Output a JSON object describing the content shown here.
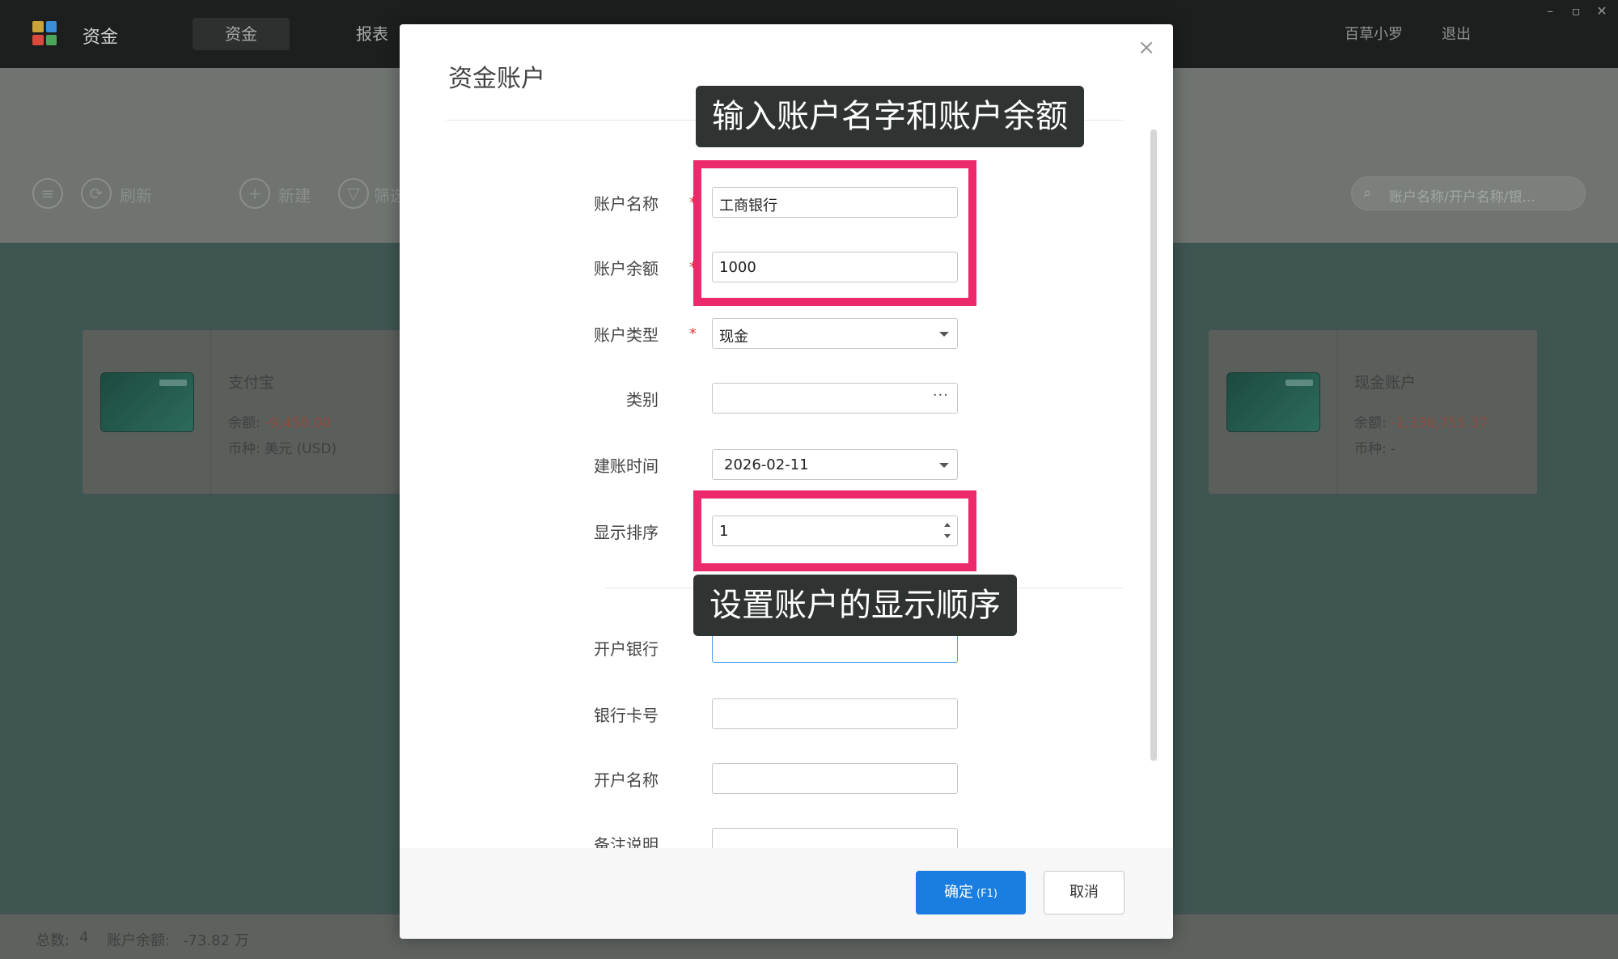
{
  "app": {
    "title": "资金",
    "nav_tabs": [
      {
        "label": "资金"
      },
      {
        "label": "报表"
      }
    ],
    "user": {
      "name": "百草小罗",
      "logout_label": "退出"
    },
    "window_controls": [
      "minimize-icon",
      "maximize-icon",
      "close-icon"
    ]
  },
  "toolbar": {
    "refresh_label": "刷新",
    "new_label": "新建",
    "filter_label": "筛选",
    "search_placeholder": "账户名称/开户名称/银..."
  },
  "accounts": [
    {
      "name": "支付宝",
      "balance_label": "余额:",
      "balance_value": "-9,458.00",
      "currency_label": "币种:",
      "currency_value": "美元 (USD)"
    },
    {
      "name": "现金账户",
      "balance_label": "余额:",
      "balance_value": "-1,336,755.37",
      "currency_label": "币种:",
      "currency_value": "-"
    }
  ],
  "footer": {
    "count_label": "总数:",
    "count_value": "4",
    "balance_label": "账户余额:",
    "balance_value": "-73.82 万"
  },
  "modal": {
    "title": "资金账户",
    "close_glyph": "×",
    "fields": {
      "account_name": {
        "label": "账户名称",
        "value": "工商银行",
        "required_mark": "*"
      },
      "account_balance": {
        "label": "账户余额",
        "value": "1000",
        "required_mark": "*"
      },
      "account_type": {
        "label": "账户类型",
        "value": "现金",
        "required_mark": "*"
      },
      "category": {
        "label": "类别",
        "value": "",
        "picker_glyph": "···"
      },
      "created_date": {
        "label": "建账时间",
        "value": "2026-02-11"
      },
      "display_order": {
        "label": "显示排序",
        "value": "1"
      },
      "bank": {
        "label": "开户银行",
        "value": ""
      },
      "card_number": {
        "label": "银行卡号",
        "value": ""
      },
      "holder_name": {
        "label": "开户名称",
        "value": ""
      },
      "remarks": {
        "label": "备注说明",
        "value": ""
      }
    },
    "ok_label": "确定",
    "ok_shortcut": "(F1)",
    "cancel_label": "取消"
  },
  "annotations": {
    "callout_top": "输入账户名字和账户余额",
    "callout_bottom": "设置账户的显示顺序",
    "highlight_color": "#ec2a6b"
  },
  "colors": {
    "primary": "#1a7ee0",
    "required": "#e03a3a",
    "negative": "#e04a2f"
  }
}
